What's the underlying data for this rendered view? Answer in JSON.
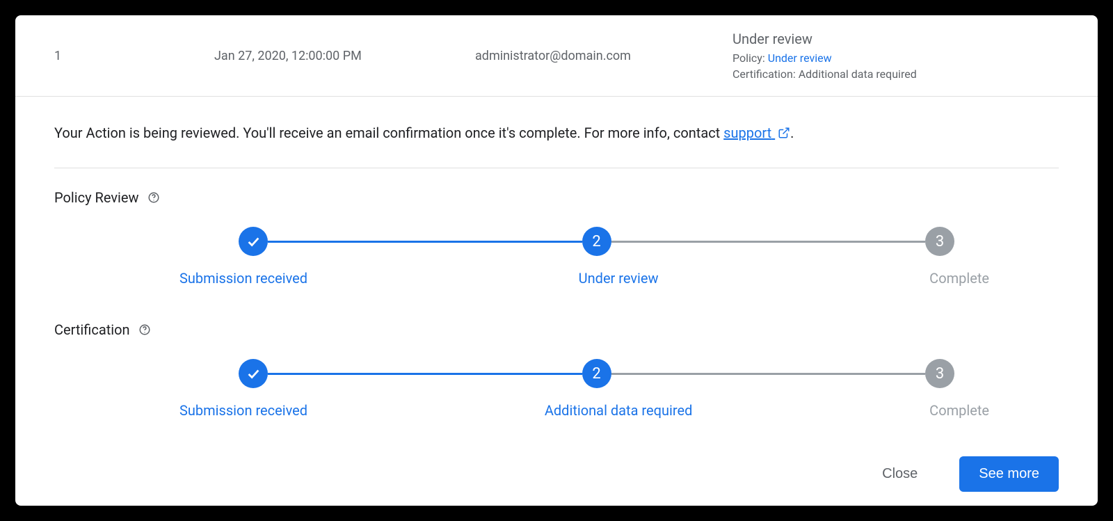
{
  "summary": {
    "number": "1",
    "date": "Jan 27, 2020, 12:00:00 PM",
    "email": "administrator@domain.com",
    "status_title": "Under review",
    "policy_label": "Policy:",
    "policy_value": "Under review",
    "cert_label": "Certification:",
    "cert_value": "Additional data required"
  },
  "intro": {
    "text_a": "Your Action is being reviewed. You'll receive an email confirmation once it's complete. For more info, contact ",
    "link_text": "support",
    "text_b": "."
  },
  "sections": {
    "policy_review": {
      "label": "Policy Review",
      "steps": [
        {
          "label": "Submission received",
          "state": "done"
        },
        {
          "label": "Under review",
          "state": "active",
          "num": "2"
        },
        {
          "label": "Complete",
          "state": "pending",
          "num": "3"
        }
      ]
    },
    "certification": {
      "label": "Certification",
      "steps": [
        {
          "label": "Submission received",
          "state": "done"
        },
        {
          "label": "Additional data required",
          "state": "active",
          "num": "2"
        },
        {
          "label": "Complete",
          "state": "pending",
          "num": "3"
        }
      ]
    }
  },
  "footer": {
    "close": "Close",
    "see_more": "See more"
  }
}
